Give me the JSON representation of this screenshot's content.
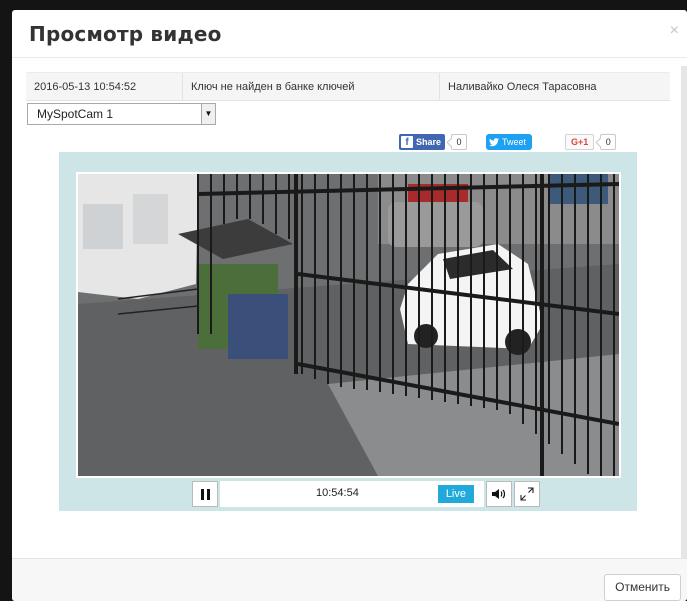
{
  "dialog": {
    "title": "Просмотр видео",
    "close_glyph": "×"
  },
  "info_row": {
    "datetime": "2016-05-13 10:54:52",
    "status": "Ключ не найден в банке ключей",
    "person": "Наливайко Олеся Тарасовна"
  },
  "camera_select": {
    "selected": "MySpotCam 1",
    "arrow_glyph": "▼"
  },
  "social": {
    "facebook": {
      "icon": "f",
      "label": "Share",
      "count": "0"
    },
    "twitter": {
      "label": "Tweet",
      "count": ""
    },
    "google_plus": {
      "label": "G+1",
      "count": "0"
    }
  },
  "player": {
    "time": "10:54:54",
    "live_label": "Live",
    "pause_icon": "pause-icon",
    "volume_icon": "volume-icon",
    "fullscreen_icon": "fullscreen-icon"
  },
  "footer": {
    "cancel_label": "Отменить"
  },
  "colors": {
    "live_badge": "#20a9da",
    "facebook": "#4267b2",
    "twitter": "#1da1f2",
    "google_plus": "#db4437",
    "player_frame": "#cde5e7"
  }
}
